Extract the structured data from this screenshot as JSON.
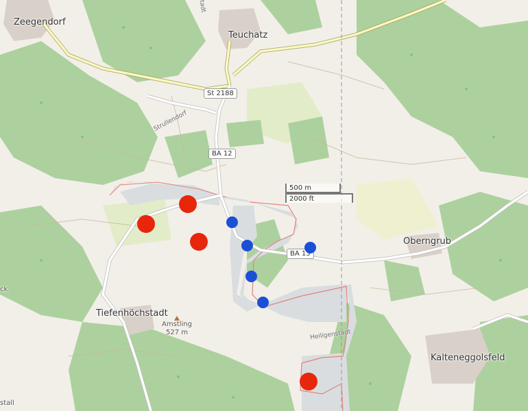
{
  "places": {
    "zeegendorf": "Zeegendorf",
    "teuchatz": "Teuchatz",
    "oberngrub": "Oberngrub",
    "tiefenhochstadt": "Tiefenhöchstadt",
    "kalteneggolsfeld": "Kalteneggolsfeld"
  },
  "edge_labels": {
    "left_ck": "ck",
    "left_stall": "stall"
  },
  "roads": {
    "st2188": "St 2188",
    "ba12": "BA 12",
    "ba13": "BA 13"
  },
  "streets": {
    "strullendorf": "Strullendorf",
    "heiligenstadt": "Heiligenstadt",
    "top_stadt": "stadt"
  },
  "peak": {
    "name": "Amstling",
    "elevation": "527 m"
  },
  "scale": {
    "metric": "500 m",
    "imperial": "2000 ft"
  },
  "colors": {
    "red_marker": "#e8260c",
    "blue_marker": "#1b4fd6",
    "forest": "#add19e",
    "zone_fill": "#d9dde0",
    "zone_border": "#e4817a"
  },
  "markers": {
    "red": [
      "marker-1",
      "marker-2",
      "marker-3",
      "marker-4"
    ],
    "blue": [
      "marker-5",
      "marker-6",
      "marker-7",
      "marker-8",
      "marker-9"
    ]
  }
}
